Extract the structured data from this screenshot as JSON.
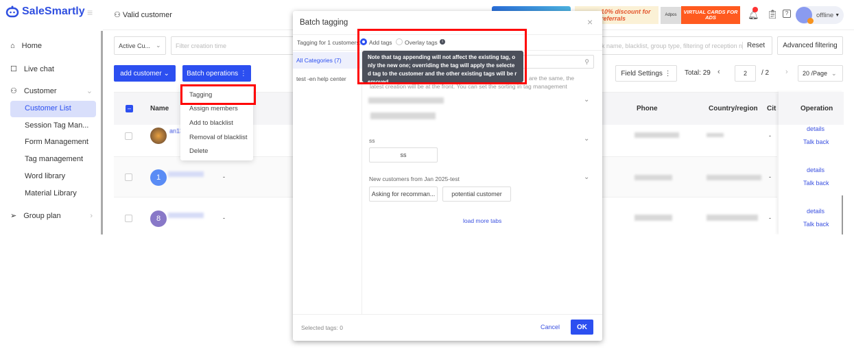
{
  "app": {
    "logo": "SaleSmartly"
  },
  "sidebar": {
    "items": [
      {
        "label": "Home",
        "icon": "home-icon"
      },
      {
        "label": "Live chat",
        "icon": "chat-icon"
      },
      {
        "label": "Customer",
        "icon": "users-icon"
      },
      {
        "label": "Group plan",
        "icon": "send-icon"
      }
    ],
    "sub_items": [
      "Customer List",
      "Session Tag Man...",
      "Form Management",
      "Tag management",
      "Word library",
      "Material Library"
    ]
  },
  "header": {
    "title": "Valid customer",
    "banner_discount": "10% discount for referrals",
    "banner_adpos": "Adpos",
    "banner_virtual": "VIRTUAL CARDS FOR ADS",
    "status": "offline"
  },
  "filters": {
    "customer_type": "Active Cu...",
    "date_placeholder": "Filter creation time",
    "search_placeholder": "k name, blacklist, group type, filtering of reception n",
    "reset": "Reset",
    "advanced": "Advanced filtering"
  },
  "toolbar": {
    "add_customer": "add customer",
    "batch_operations": "Batch operations",
    "field_settings": "Field Settings",
    "total_label": "Total:",
    "total": "29",
    "page": "2",
    "page_count": "/ 2",
    "page_size": "20 /Page"
  },
  "table": {
    "columns": [
      "Name",
      "Phone",
      "Country/region",
      "Cit",
      "Operation"
    ],
    "rows": [
      {
        "avatar": "",
        "name_prefix": "an13",
        "city": "-",
        "actions": [
          "details",
          "Talk back"
        ]
      },
      {
        "avatar": "1",
        "extra": "-",
        "city": "-",
        "actions": [
          "details",
          "Talk back"
        ]
      },
      {
        "avatar": "8",
        "extra": "-",
        "city": "-",
        "actions": [
          "details",
          "Talk back"
        ]
      }
    ]
  },
  "batch_menu": [
    "Tagging",
    "Assign members",
    "Add to blacklist",
    "Removal of blacklist",
    "Delete"
  ],
  "dialog": {
    "title": "Batch tagging",
    "tagging_for": "Tagging for 1 customers:",
    "mode_add": "Add tags",
    "mode_overlay": "Overlay tags",
    "tooltip": "Note that tag appending will not affect the existing tag, only the new one; overriding the tag will apply the selected tag to the customer and the other existing tags will be removed",
    "categories": [
      "All Categories (7)",
      "test -en help center"
    ],
    "hint": "are the same, the latest creation will be at the front. You can set the sorting in tag management",
    "groups": [
      {
        "name": "ss",
        "tags": [
          "ss"
        ]
      },
      {
        "name": "New customers from Jan 2025-test",
        "tags": [
          "Asking for recomman...",
          "potential customer"
        ]
      }
    ],
    "load_more": "load more tabs",
    "selected": "Selected tags: 0",
    "cancel": "Cancel",
    "ok": "OK"
  },
  "colors": {
    "primary": "#2c4ff0",
    "highlight": "#ff0000",
    "tooltip": "#4b4f5a"
  }
}
